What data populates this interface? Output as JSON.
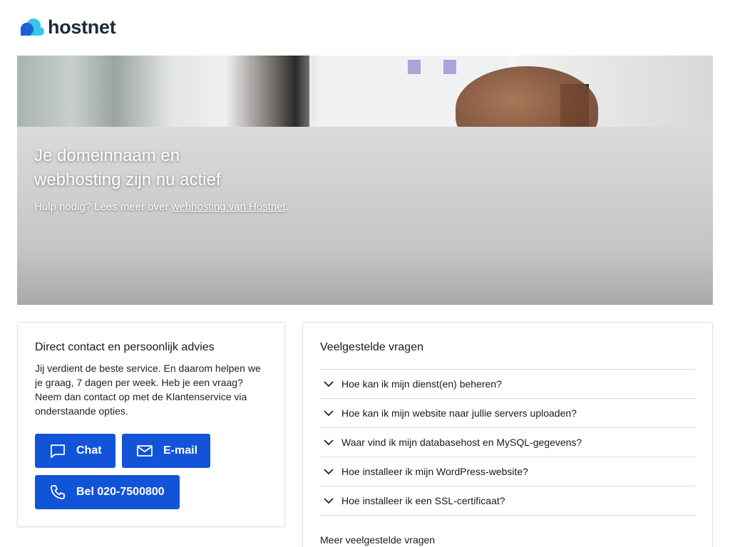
{
  "brand": {
    "name": "hostnet",
    "colors": {
      "primary_button": "#1254d8",
      "logo_dark": "#1e2a3a",
      "logo_cloud_blue": "#1a5fd4",
      "logo_cloud_light": "#35c6e8"
    }
  },
  "hero": {
    "title": "Je domeinnaam en webhosting zijn nu actief",
    "sub_prefix": "Hulp nodig? Lees meer over ",
    "sub_link": "webhosting van Hostnet",
    "sub_suffix": "."
  },
  "contact": {
    "title": "Direct contact en persoonlijk advies",
    "text": "Jij verdient de beste service. En daarom helpen we je graag, 7 dagen per week. Heb je een vraag? Neem dan contact op met de Klantenservice via onderstaande opties.",
    "buttons": [
      {
        "label": "Chat",
        "icon": "chat-bubble-icon"
      },
      {
        "label": "E-mail",
        "icon": "envelope-icon"
      },
      {
        "label": "Bel 020-7500800",
        "icon": "phone-icon"
      }
    ]
  },
  "faq": {
    "title": "Veelgestelde vragen",
    "items": [
      {
        "question": "Hoe kan ik mijn dienst(en) beheren?"
      },
      {
        "question": "Hoe kan ik mijn website naar jullie servers uploaden?"
      },
      {
        "question": "Waar vind ik mijn databasehost en MySQL-gegevens?"
      },
      {
        "question": "Hoe installeer ik mijn WordPress-website?"
      },
      {
        "question": "Hoe installeer ik een SSL-certificaat?"
      }
    ],
    "more_label": "Meer veelgestelde vragen",
    "item_icon": "chevron-down-icon"
  }
}
